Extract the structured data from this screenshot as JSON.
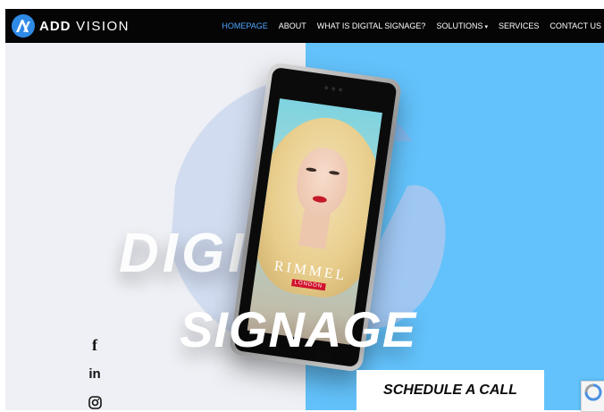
{
  "header": {
    "logo_text_bold": "ADD",
    "logo_text": "VISION",
    "nav": [
      {
        "label": "HOMEPAGE",
        "active": true
      },
      {
        "label": "ABOUT"
      },
      {
        "label": "WHAT IS DIGITAL SIGNAGE?"
      },
      {
        "label": "SOLUTIONS",
        "dropdown": true
      },
      {
        "label": "SERVICES"
      },
      {
        "label": "CONTACT US"
      }
    ]
  },
  "hero": {
    "word1": "DIGITAL",
    "word2": "SIGNAGE",
    "cta_label": "SCHEDULE A CALL",
    "screen_ad": {
      "brand": "RIMMEL",
      "sub": "LONDON"
    }
  },
  "social": [
    {
      "icon": "facebook-icon",
      "glyph": "f"
    },
    {
      "icon": "linkedin-icon",
      "glyph": "in"
    },
    {
      "icon": "instagram-icon"
    }
  ],
  "colors": {
    "header_bg": "#050505",
    "nav_active": "#4ea6ff",
    "hero_left": "#eef0f5",
    "hero_right": "#63c2fb",
    "logo_blue": "#2f8ae6"
  }
}
